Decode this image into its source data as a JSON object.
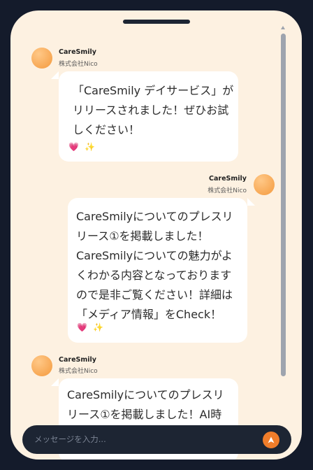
{
  "messages": [
    {
      "sender": "CareSmily",
      "company": "株式会社Nico",
      "text": "「CareSmily デイサービス」が\nリリースされました！ぜひお試\nしください！",
      "reactions": [
        "💗",
        "✨"
      ]
    },
    {
      "sender": "CareSmily",
      "company": "株式会社Nico",
      "text": "CareSmilyについてのプレスリ\nリース①を掲載しました！\nCareSmilyについての魅力がよ\nくわかる内容となっております\nので是非ご覧ください！詳細は\n「メディア情報」をCheck！",
      "reactions": [
        "💗",
        "✨"
      ]
    },
    {
      "sender": "CareSmily",
      "company": "株式会社Nico",
      "text": "CareSmilyについてのプレスリ\nリース①を掲載しました！AI時",
      "reactions": []
    }
  ],
  "input": {
    "placeholder": "メッセージを入力..."
  },
  "colors": {
    "background": "#141b2b",
    "panel": "#fdf1e1",
    "accent": "#f07d2a"
  },
  "icons": {
    "send": "arrow-up-icon",
    "reaction_1": "heart-icon",
    "reaction_2": "sparkles-icon"
  }
}
